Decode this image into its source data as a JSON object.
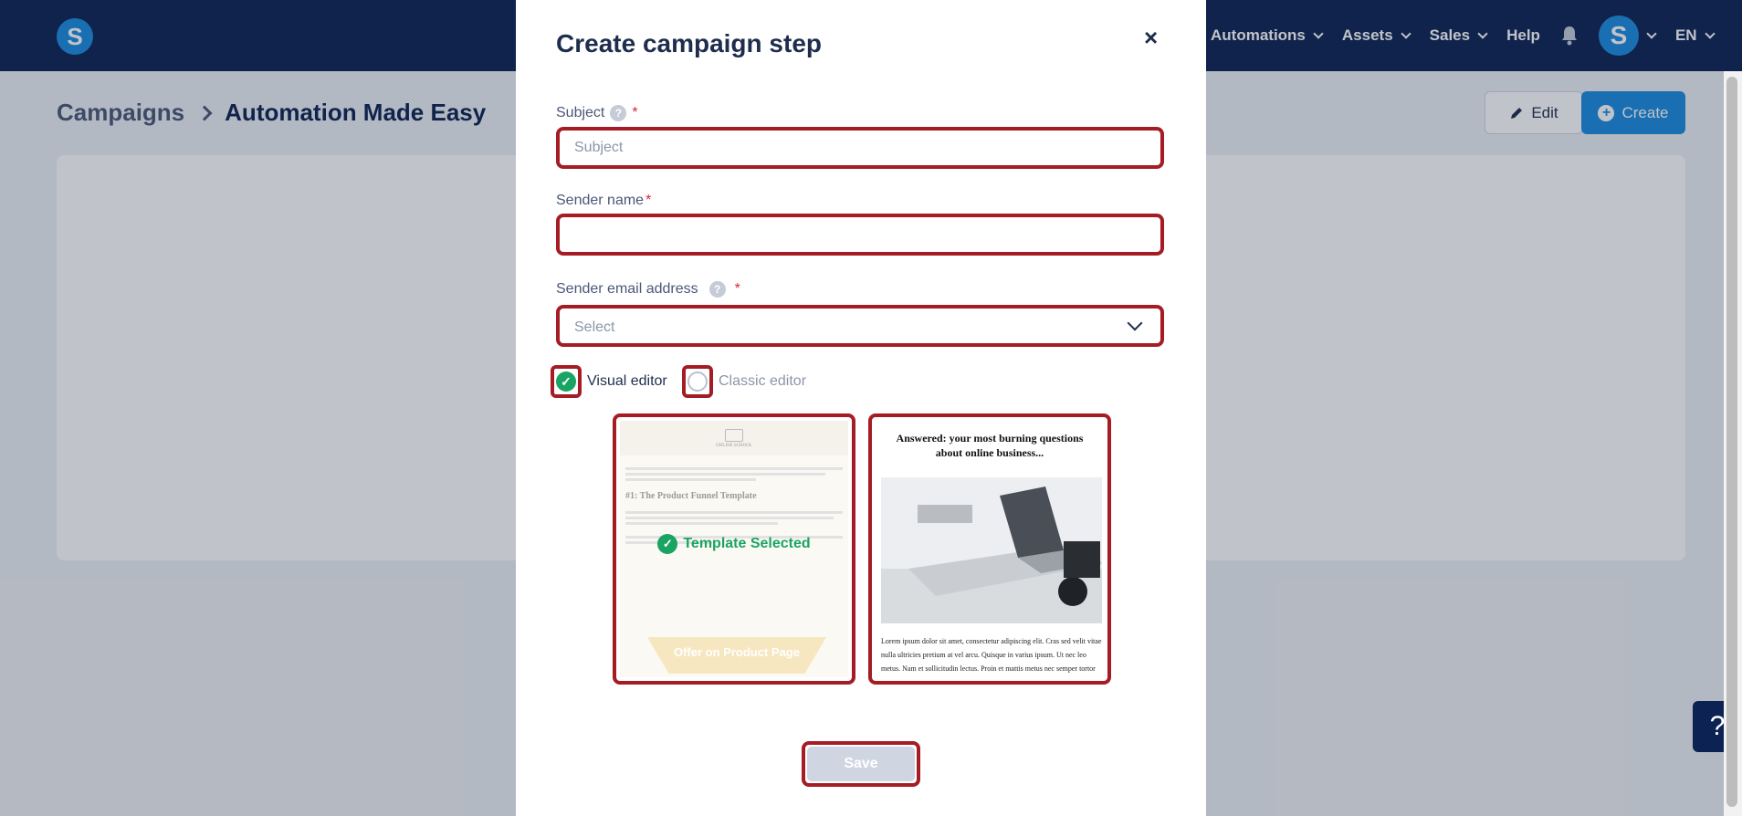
{
  "nav": {
    "logo_letter": "S",
    "items": [
      {
        "label": "Automations"
      },
      {
        "label": "Assets"
      },
      {
        "label": "Sales"
      },
      {
        "label": "Help"
      }
    ],
    "avatar_letter": "S",
    "language": "EN"
  },
  "page": {
    "breadcrumb_parent": "Campaigns",
    "breadcrumb_current": "Automation Made Easy",
    "edit_label": "Edit",
    "create_label": "Create"
  },
  "modal": {
    "title": "Create campaign step",
    "close": "×",
    "subject": {
      "label": "Subject",
      "required": "*",
      "placeholder": "Subject",
      "value": ""
    },
    "sender_name": {
      "label": "Sender name",
      "required": "*",
      "value": ""
    },
    "sender_email": {
      "label": "Sender email address",
      "required": "*",
      "placeholder": "Select"
    },
    "editor": {
      "visual_label": "Visual editor",
      "classic_label": "Classic editor",
      "selected": "visual"
    },
    "templates": [
      {
        "selected_label": "Template Selected",
        "logo_text": "ONLINE SCHOOL",
        "heading": "#1: The Product Funnel Template",
        "banner": "Offer on Product Page"
      },
      {
        "title": "Answered: your most burning questions about online business...",
        "body": "Lorem ipsum dolor sit amet, consectetur adipiscing elit. Cras sed velit vitae nulla ultricies pretium at vel arcu. Quisque in varius ipsum. Ut nec leo metus. Nam et sollicitudin lectus. Proin et mattis metus nec semper tortor"
      }
    ],
    "save_label": "Save"
  },
  "help_tab": "?",
  "colors": {
    "nav_bg": "#0c2253",
    "accent": "#1a8be0",
    "highlight": "#a51c24",
    "success": "#1aa463"
  }
}
